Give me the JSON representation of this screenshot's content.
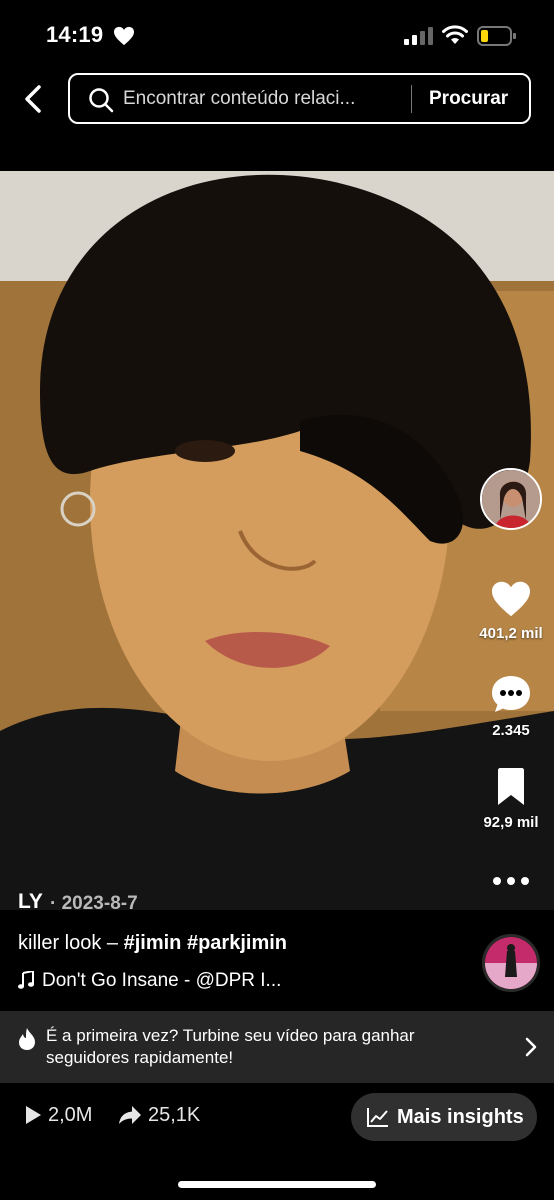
{
  "status_bar": {
    "time": "14:19",
    "heart_icon": "heart-icon",
    "battery_level": 0.2,
    "battery_color": "#FFD60A"
  },
  "search": {
    "placeholder": "Encontrar conteúdo relaci...",
    "button_label": "Procurar"
  },
  "rail": {
    "likes": "401,2 mil",
    "comments": "2.345",
    "saves": "92,9 mil"
  },
  "post": {
    "author": "LY",
    "date": "· 2023-8-7",
    "caption_text": "killer look – ",
    "hashtags": [
      "#jimin",
      "#parkjimin"
    ],
    "music": "Don't Go Insane - @DPR I..."
  },
  "promo": {
    "text": "É a primeira vez? Turbine seu vídeo para ganhar seguidores rapidamente!"
  },
  "stats": {
    "views": "2,0M",
    "shares": "25,1K",
    "insights_label": "Mais insights"
  },
  "colors": {
    "background": "#000000",
    "banner": "#262626",
    "pill": "#303030"
  }
}
